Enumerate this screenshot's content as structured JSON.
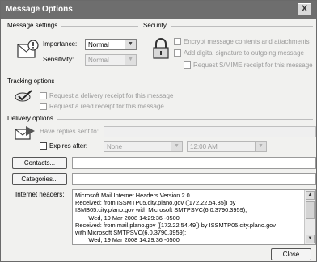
{
  "window": {
    "title": "Message Options",
    "close_glyph": "X"
  },
  "message_settings": {
    "heading": "Message settings",
    "importance_label": "Importance:",
    "importance_value": "Normal",
    "sensitivity_label": "Sensitivity:",
    "sensitivity_value": "Normal",
    "icon": "envelope-importance-icon"
  },
  "security": {
    "heading": "Security",
    "icon": "lock-settings-icon",
    "options": [
      {
        "label": "Encrypt message contents and attachments",
        "checked": false
      },
      {
        "label": "Add digital signature to outgoing message",
        "checked": false
      },
      {
        "label": "Request S/MIME receipt for this message",
        "checked": false
      }
    ]
  },
  "tracking": {
    "heading": "Tracking options",
    "icon": "checkmark-tracking-icon",
    "options": [
      {
        "label": "Request a delivery receipt for this message",
        "checked": false
      },
      {
        "label": "Request a read receipt for this message",
        "checked": false
      }
    ]
  },
  "delivery": {
    "heading": "Delivery options",
    "icon": "envelope-delivery-icon",
    "replies_label": "Have replies sent to:",
    "replies_value": "",
    "expires_label": "Expires after:",
    "expires_checked": false,
    "expires_date": "None",
    "expires_time": "12:00 AM"
  },
  "contacts_button": "Contacts...",
  "categories_button": "Categories...",
  "internet_headers": {
    "label": "Internet headers:",
    "lines": [
      "Microsoft Mail Internet Headers Version 2.0",
      "Received: from ISSMTP05.city.plano.gov ([172.22.54.35]) by",
      "ISMB05.city.plano.gov with Microsoft SMTPSVC(6.0.3790.3959);",
      "        Wed, 19 Mar 2008 14:29:36 -0500",
      "Received: from mail.plano.gov ([172.22.54.49]) by ISSMTP05.city.plano.gov",
      "with Microsoft SMTPSVC(6.0.3790.3959);",
      "        Wed, 19 Mar 2008 14:29:36 -0500"
    ]
  },
  "close_button": "Close"
}
